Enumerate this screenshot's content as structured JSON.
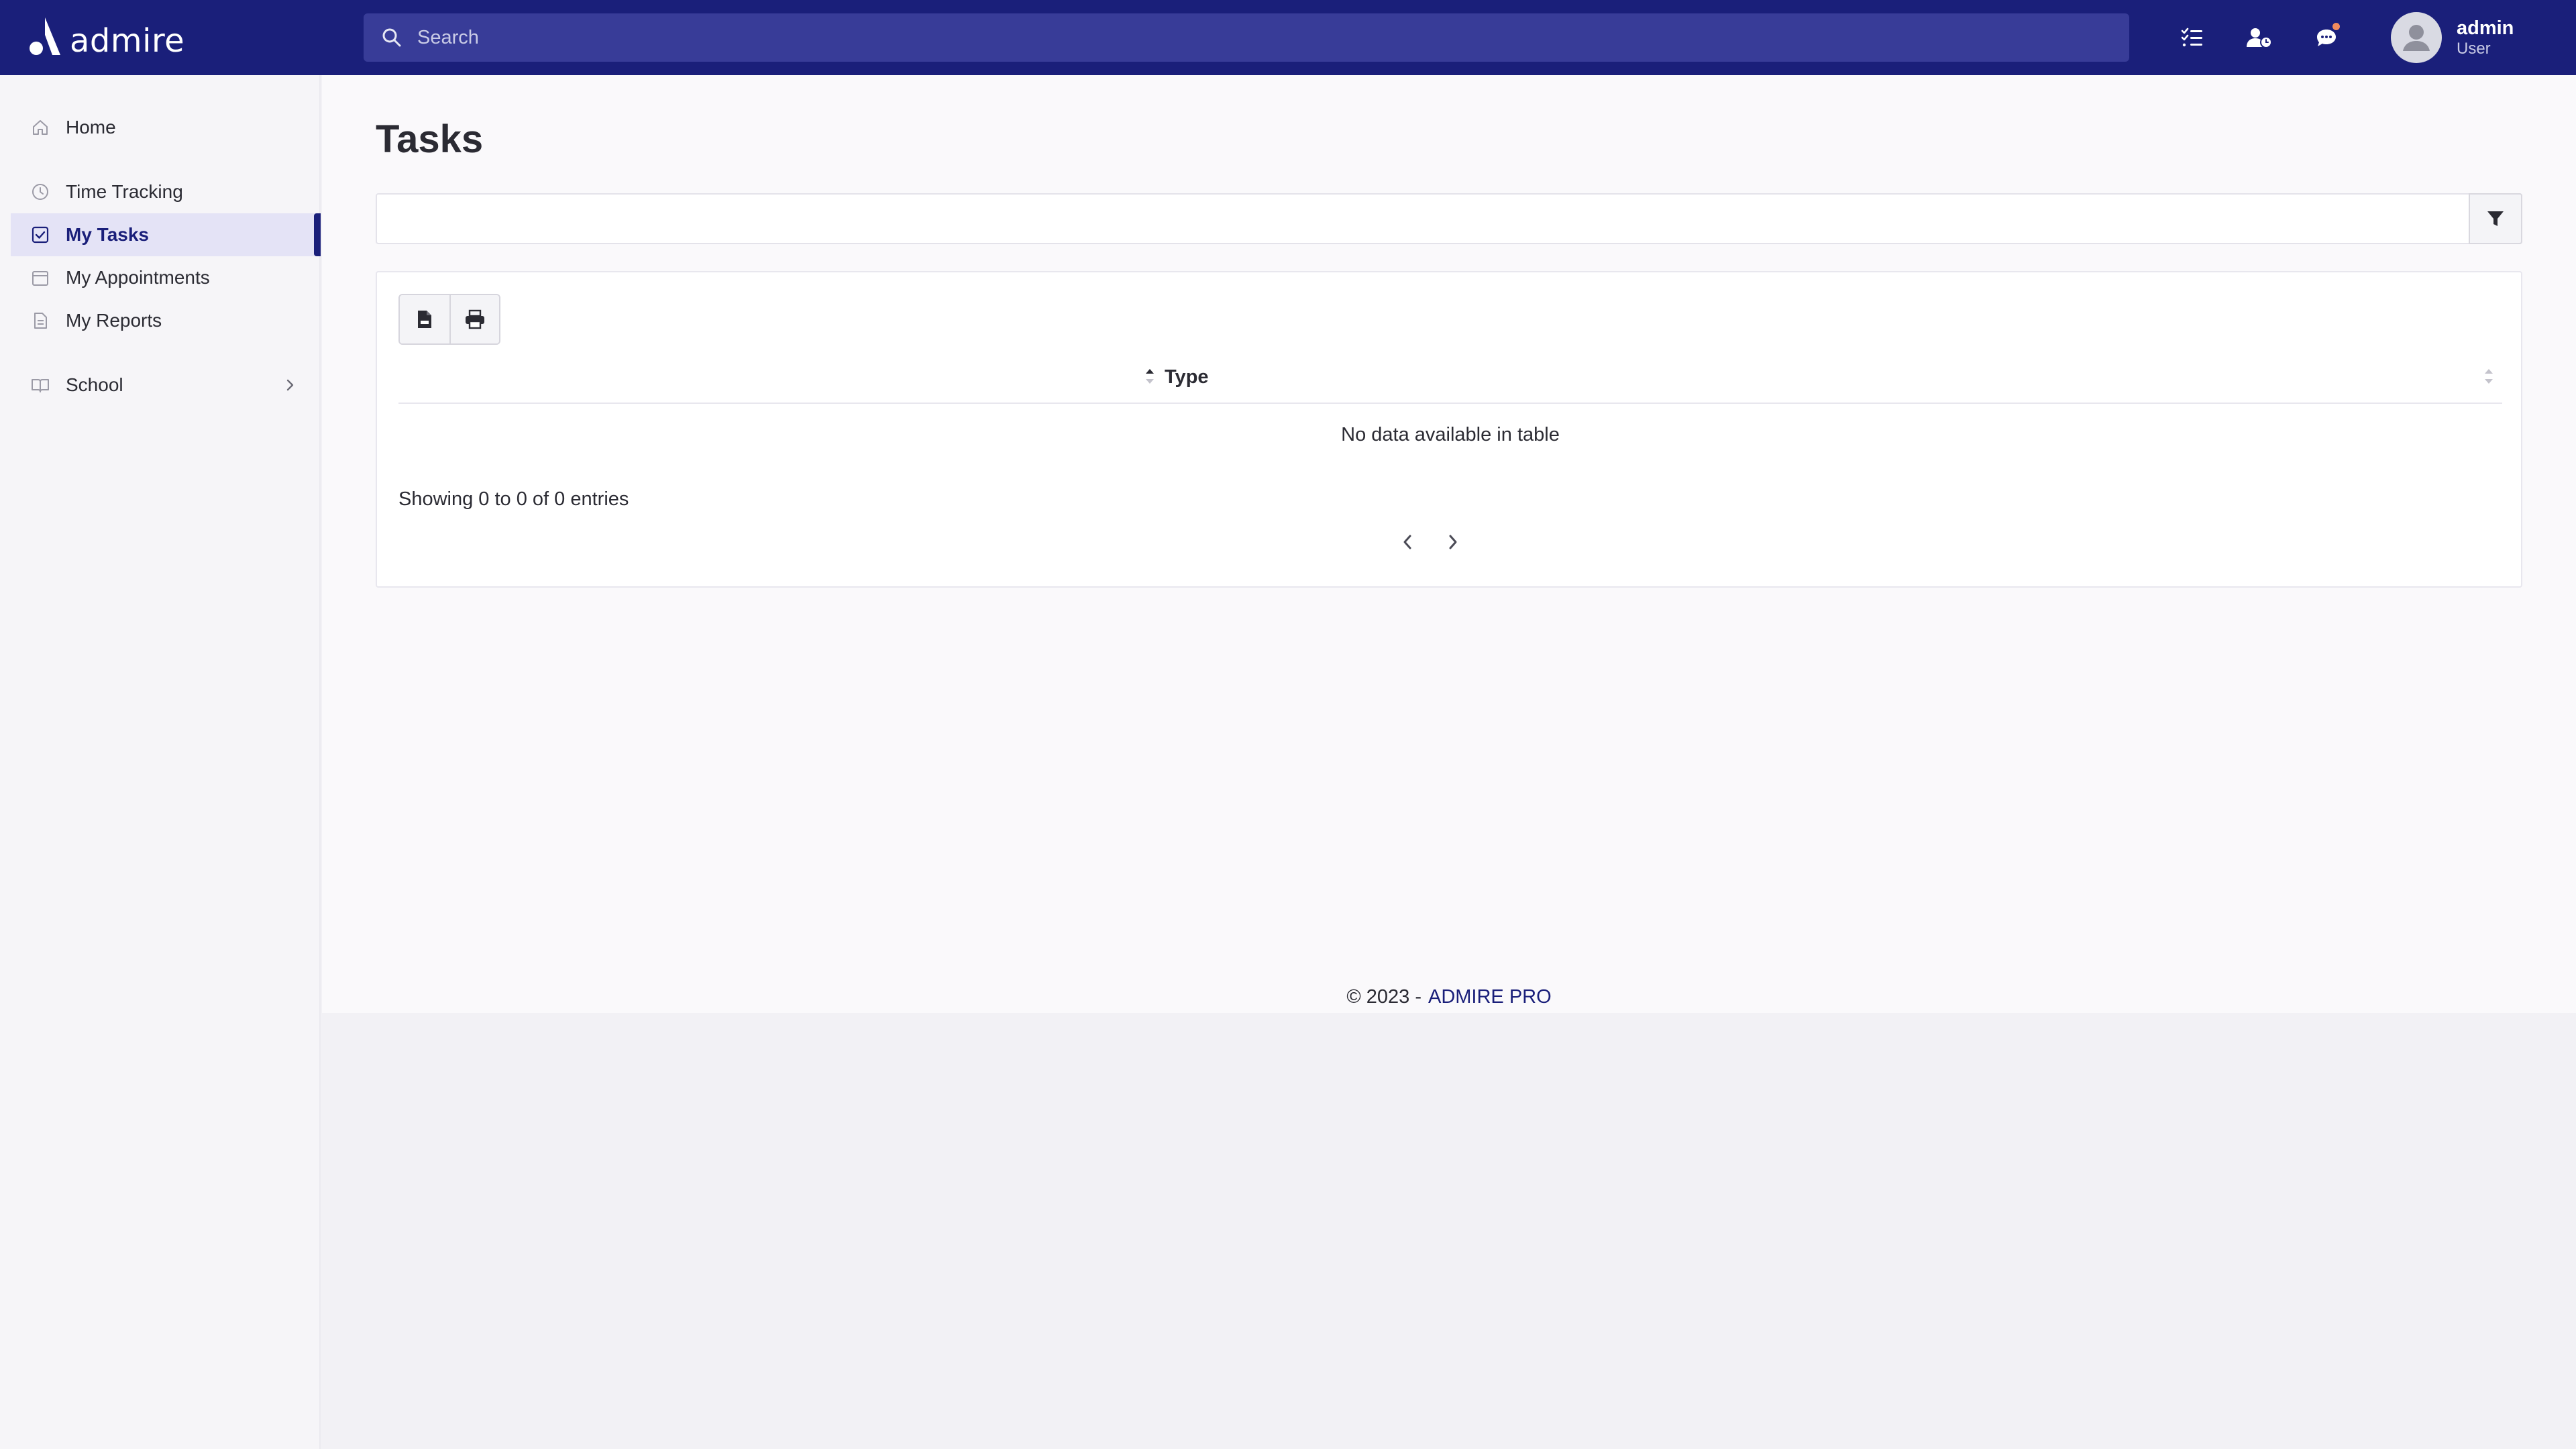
{
  "app": {
    "brand": "admire"
  },
  "header": {
    "search_placeholder": "Search",
    "user": {
      "name": "admin",
      "role": "User"
    },
    "icons": [
      "task-list-icon",
      "user-clock-icon",
      "chat-icon"
    ],
    "accent": "#1a1f7a",
    "notification_dot_color": "#f08a5d"
  },
  "sidebar": {
    "items": [
      {
        "label": "Home",
        "icon": "home-icon",
        "active": false
      },
      {
        "label": "Time Tracking",
        "icon": "clock-icon",
        "active": false
      },
      {
        "label": "My Tasks",
        "icon": "checkbox-icon",
        "active": true
      },
      {
        "label": "My Appointments",
        "icon": "calendar-icon",
        "active": false
      },
      {
        "label": "My Reports",
        "icon": "report-icon",
        "active": false
      },
      {
        "label": "School",
        "icon": "book-icon",
        "active": false,
        "has_submenu": true
      }
    ]
  },
  "main": {
    "title": "Tasks",
    "table": {
      "columns": [
        "",
        "Type"
      ],
      "empty_message": "No data available in table",
      "info": "Showing 0 to 0 of 0 entries",
      "tools": [
        "export-csv-icon",
        "print-icon"
      ]
    }
  },
  "footer": {
    "copyright": "© 2023 -",
    "link_text": "ADMIRE PRO"
  }
}
